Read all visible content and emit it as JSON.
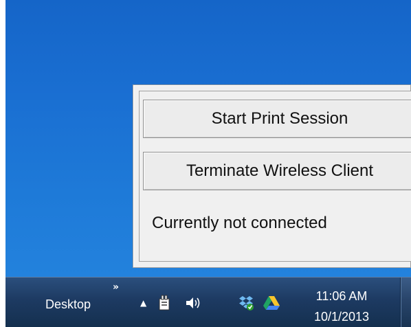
{
  "popup": {
    "start_button_label": "Start Print Session",
    "terminate_button_label": "Terminate Wireless Client",
    "status_text": "Currently not connected"
  },
  "taskbar": {
    "desktop_label": "Desktop",
    "toolbar_chevron": "»",
    "overflow_arrow": "▲",
    "time": "11:06 AM",
    "date": "10/1/2013",
    "tray_icons": [
      "power-icon",
      "volume-icon",
      "dropbox-icon",
      "google-drive-icon"
    ]
  },
  "colors": {
    "desktop_blue": "#1e7ad8",
    "taskbar_dark": "#1d3a62",
    "dialog_gray": "#f0f0f0"
  }
}
